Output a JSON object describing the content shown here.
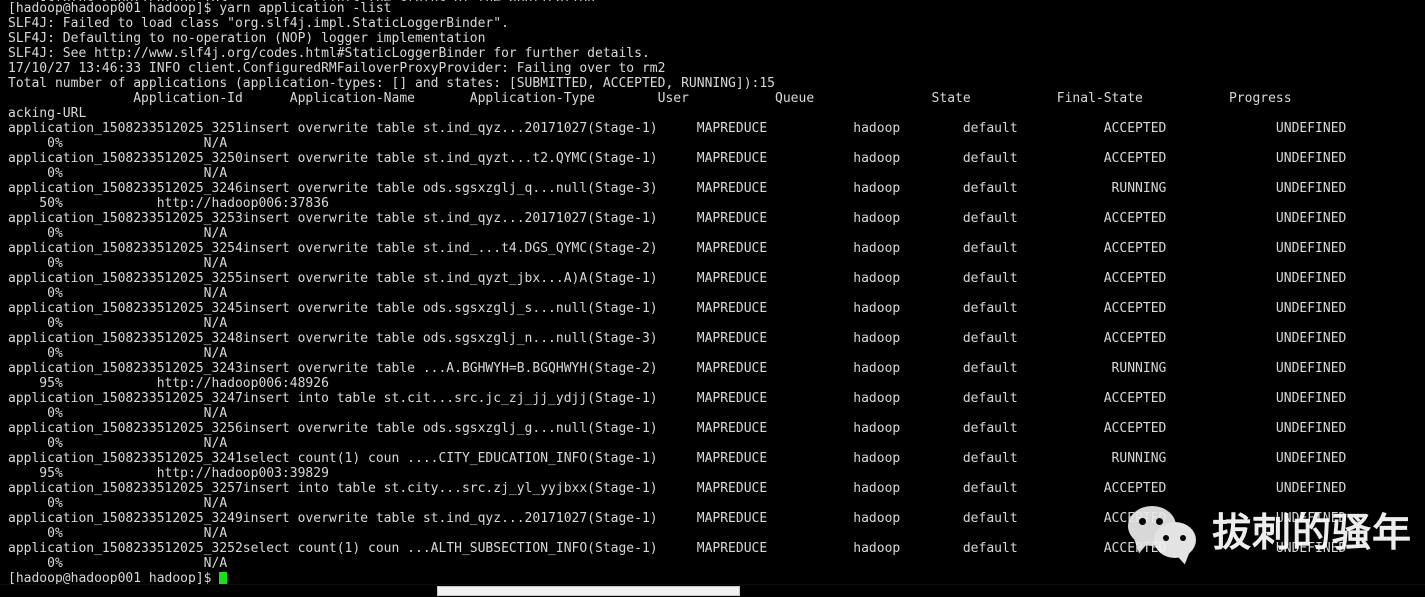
{
  "terminal": {
    "partial_top_line": "    -status <Application ID>           Prints the status of the application.",
    "prompt_line": "[hadoop@hadoop001 hadoop]$ yarn application -list",
    "log_lines": [
      "SLF4J: Failed to load class \"org.slf4j.impl.StaticLoggerBinder\".",
      "SLF4J: Defaulting to no-operation (NOP) logger implementation",
      "SLF4J: See http://www.slf4j.org/codes.html#StaticLoggerBinder for further details.",
      "17/10/27 13:46:33 INFO client.ConfiguredRMFailoverProxyProvider: Failing over to rm2",
      "Total number of applications (application-types: [] and states: [SUBMITTED, ACCEPTED, RUNNING]):15"
    ],
    "header_line_1": "                Application-Id      Application-Name       Application-Type        User           Queue               State           Final-State           Progress                       Tr",
    "header_line_2": "acking-URL",
    "final_prompt": "[hadoop@hadoop001 hadoop]$ ",
    "cursor": "block"
  },
  "table": {
    "columns": [
      "Application-Id",
      "Application-Name",
      "Application-Type",
      "User",
      "Queue",
      "State",
      "Final-State",
      "Progress",
      "Tracking-URL"
    ],
    "total_applications": 15,
    "rows": [
      {
        "id": "application_1508233512025_3251",
        "name": "insert overwrite table st.ind_qyz...20171027(Stage-1)",
        "type": "MAPREDUCE",
        "user": "hadoop",
        "queue": "default",
        "state": "ACCEPTED",
        "final_state": "UNDEFINED",
        "progress": "0%",
        "tracking_url": "N/A"
      },
      {
        "id": "application_1508233512025_3250",
        "name": "insert overwrite table st.ind_qyzt...t2.QYMC(Stage-1)",
        "type": "MAPREDUCE",
        "user": "hadoop",
        "queue": "default",
        "state": "ACCEPTED",
        "final_state": "UNDEFINED",
        "progress": "0%",
        "tracking_url": "N/A"
      },
      {
        "id": "application_1508233512025_3246",
        "name": "insert overwrite table ods.sgsxzglj_q...null(Stage-3)",
        "type": "MAPREDUCE",
        "user": "hadoop",
        "queue": "default",
        "state": "RUNNING",
        "final_state": "UNDEFINED",
        "progress": "50%",
        "tracking_url": "http://hadoop006:37836"
      },
      {
        "id": "application_1508233512025_3253",
        "name": "insert overwrite table st.ind_qyz...20171027(Stage-1)",
        "type": "MAPREDUCE",
        "user": "hadoop",
        "queue": "default",
        "state": "ACCEPTED",
        "final_state": "UNDEFINED",
        "progress": "0%",
        "tracking_url": "N/A"
      },
      {
        "id": "application_1508233512025_3254",
        "name": "insert overwrite table st.ind_...t4.DGS_QYMC(Stage-2)",
        "type": "MAPREDUCE",
        "user": "hadoop",
        "queue": "default",
        "state": "ACCEPTED",
        "final_state": "UNDEFINED",
        "progress": "0%",
        "tracking_url": "N/A"
      },
      {
        "id": "application_1508233512025_3255",
        "name": "insert overwrite table st.ind_qyzt_jbx...A)A(Stage-1)",
        "type": "MAPREDUCE",
        "user": "hadoop",
        "queue": "default",
        "state": "ACCEPTED",
        "final_state": "UNDEFINED",
        "progress": "0%",
        "tracking_url": "N/A"
      },
      {
        "id": "application_1508233512025_3245",
        "name": "insert overwrite table ods.sgsxzglj_s...null(Stage-1)",
        "type": "MAPREDUCE",
        "user": "hadoop",
        "queue": "default",
        "state": "ACCEPTED",
        "final_state": "UNDEFINED",
        "progress": "0%",
        "tracking_url": "N/A"
      },
      {
        "id": "application_1508233512025_3248",
        "name": "insert overwrite table ods.sgsxzglj_n...null(Stage-3)",
        "type": "MAPREDUCE",
        "user": "hadoop",
        "queue": "default",
        "state": "ACCEPTED",
        "final_state": "UNDEFINED",
        "progress": "0%",
        "tracking_url": "N/A"
      },
      {
        "id": "application_1508233512025_3243",
        "name": "insert overwrite table ...A.BGHWYH=B.BGQHWYH(Stage-2)",
        "type": "MAPREDUCE",
        "user": "hadoop",
        "queue": "default",
        "state": "RUNNING",
        "final_state": "UNDEFINED",
        "progress": "95%",
        "tracking_url": "http://hadoop006:48926"
      },
      {
        "id": "application_1508233512025_3247",
        "name": "insert into table st.cit...src.jc_zj_jj_ydjj(Stage-1)",
        "type": "MAPREDUCE",
        "user": "hadoop",
        "queue": "default",
        "state": "ACCEPTED",
        "final_state": "UNDEFINED",
        "progress": "0%",
        "tracking_url": "N/A"
      },
      {
        "id": "application_1508233512025_3256",
        "name": "insert overwrite table ods.sgsxzglj_g...null(Stage-1)",
        "type": "MAPREDUCE",
        "user": "hadoop",
        "queue": "default",
        "state": "ACCEPTED",
        "final_state": "UNDEFINED",
        "progress": "0%",
        "tracking_url": "N/A"
      },
      {
        "id": "application_1508233512025_3241",
        "name": "select count(1) coun ....CITY_EDUCATION_INFO(Stage-1)",
        "type": "MAPREDUCE",
        "user": "hadoop",
        "queue": "default",
        "state": "RUNNING",
        "final_state": "UNDEFINED",
        "progress": "95%",
        "tracking_url": "http://hadoop003:39829"
      },
      {
        "id": "application_1508233512025_3257",
        "name": "insert into table st.city...src.zj_yl_yyjbxx(Stage-1)",
        "type": "MAPREDUCE",
        "user": "hadoop",
        "queue": "default",
        "state": "ACCEPTED",
        "final_state": "UNDEFINED",
        "progress": "0%",
        "tracking_url": "N/A"
      },
      {
        "id": "application_1508233512025_3249",
        "name": "insert overwrite table st.ind_qyz...20171027(Stage-1)",
        "type": "MAPREDUCE",
        "user": "hadoop",
        "queue": "default",
        "state": "ACCEPTED",
        "final_state": "UNDEFINED",
        "progress": "0%",
        "tracking_url": "N/A"
      },
      {
        "id": "application_1508233512025_3252",
        "name": "select count(1) coun ...ALTH_SUBSECTION_INFO(Stage-1)",
        "type": "MAPREDUCE",
        "user": "hadoop",
        "queue": "default",
        "state": "ACCEPTED",
        "final_state": "UNDEFINED",
        "progress": "0%",
        "tracking_url": "N/A"
      }
    ]
  },
  "watermark": {
    "text": "拔刺的骚年",
    "icon": "wechat-icon"
  },
  "scrollbar": {
    "orientation": "horizontal",
    "thumb_color": "#f2f2f2"
  },
  "colors": {
    "background": "#000000",
    "foreground": "#d8d8d8",
    "cursor": "#19e019"
  }
}
